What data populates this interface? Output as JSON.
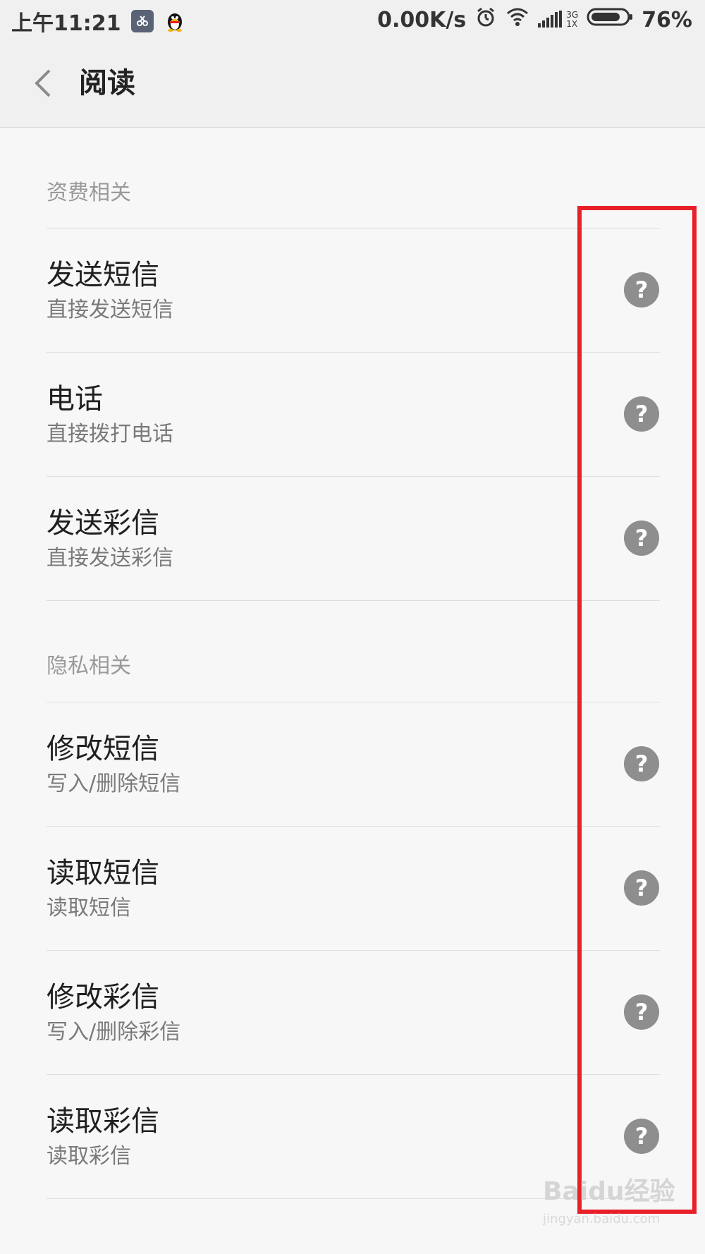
{
  "status_bar": {
    "time": "上午11:21",
    "net_speed": "0.00K/s",
    "network_type_top": "3G",
    "network_type_bottom": "1X",
    "battery": "76%"
  },
  "header": {
    "title": "阅读"
  },
  "sections": [
    {
      "title": "资费相关",
      "items": [
        {
          "title": "发送短信",
          "subtitle": "直接发送短信"
        },
        {
          "title": "电话",
          "subtitle": "直接拨打电话"
        },
        {
          "title": "发送彩信",
          "subtitle": "直接发送彩信"
        }
      ]
    },
    {
      "title": "隐私相关",
      "items": [
        {
          "title": "修改短信",
          "subtitle": "写入/删除短信"
        },
        {
          "title": "读取短信",
          "subtitle": "读取短信"
        },
        {
          "title": "修改彩信",
          "subtitle": "写入/删除彩信"
        },
        {
          "title": "读取彩信",
          "subtitle": "读取彩信"
        }
      ]
    }
  ],
  "help_icon_glyph": "?",
  "colors": {
    "highlight": "#e8202a",
    "help_icon_bg": "#8e8e8e"
  },
  "watermark": {
    "brand": "Baidu经验",
    "url": "jingyan.baidu.com"
  }
}
